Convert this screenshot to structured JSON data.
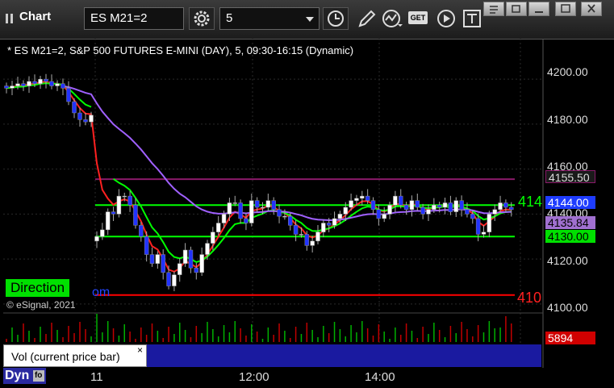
{
  "toolbar": {
    "title": "Chart",
    "symbol": "ES M21=2",
    "interval": "5",
    "get_label": "GET"
  },
  "chart": {
    "description": "* ES M21=2, S&P 500 FUTURES E-MINI (DAY), 5, 09:30-16:15 (Dynamic)",
    "y_ticks": [
      "4200.00",
      "4180.00",
      "4160.00",
      "4140.00",
      "4120.00",
      "4100.00"
    ],
    "price_labels": {
      "resistance": "4155.50",
      "last": "4144.00",
      "ma": "4135.84",
      "support": "4130.00"
    },
    "direction_label": "Direction",
    "copyright": "© eSignal, 2021",
    "edge_text_green": "414",
    "edge_text_red": "410",
    "edge_text_blue": "om"
  },
  "volume": {
    "label": "Vol (current price bar)",
    "close_glyph": "×",
    "value": "5894"
  },
  "time_axis": {
    "dyn_label": "Dyn",
    "labels": [
      "11",
      "12:00",
      "14:00"
    ]
  },
  "chart_data": {
    "type": "candlestick",
    "title": "* ES M21=2, S&P 500 FUTURES E-MINI (DAY), 5, 09:30-16:15 (Dynamic)",
    "ylim": [
      4096,
      4218
    ],
    "y_ticks": [
      4100,
      4120,
      4140,
      4160,
      4180,
      4200
    ],
    "x_labels": [
      "11",
      "12:00",
      "14:00"
    ],
    "levels": [
      {
        "value": 4155.5,
        "color": "#8a1a6a"
      },
      {
        "value": 4144.0,
        "color": "#00ff00"
      },
      {
        "value": 4130.0,
        "color": "#00ff00"
      },
      {
        "value": 4104.0,
        "color": "#ff0000"
      }
    ],
    "colors": {
      "up": "#ffffff",
      "down": "#2233ff",
      "fast_ma": "#ff2020",
      "slow_ma": "#a060ff",
      "green_ma": "#00ff00"
    },
    "day1_closes": [
      4196,
      4197,
      4198,
      4197,
      4199,
      4198,
      4200,
      4199,
      4197,
      4198,
      4196,
      4190,
      4185,
      4182,
      4181,
      4184
    ],
    "closes": [
      4130,
      4133,
      4141,
      4140,
      4148,
      4148,
      4144,
      4135,
      4130,
      4122,
      4118,
      4122,
      4114,
      4108,
      4113,
      4118,
      4124,
      4116,
      4114,
      4122,
      4127,
      4132,
      4136,
      4140,
      4145,
      4145,
      4138,
      4136,
      4146,
      4143,
      4143,
      4146,
      4142,
      4139,
      4139,
      4135,
      4131,
      4131,
      4126,
      4128,
      4132,
      4136,
      4135,
      4138,
      4140,
      4143,
      4146,
      4147,
      4148,
      4146,
      4142,
      4138,
      4140,
      4144,
      4148,
      4144,
      4142,
      4146,
      4143,
      4140,
      4142,
      4144,
      4143,
      4145,
      4141,
      4146,
      4142,
      4140,
      4138,
      4131,
      4132,
      4140,
      4142,
      4145,
      4143,
      4142
    ]
  }
}
